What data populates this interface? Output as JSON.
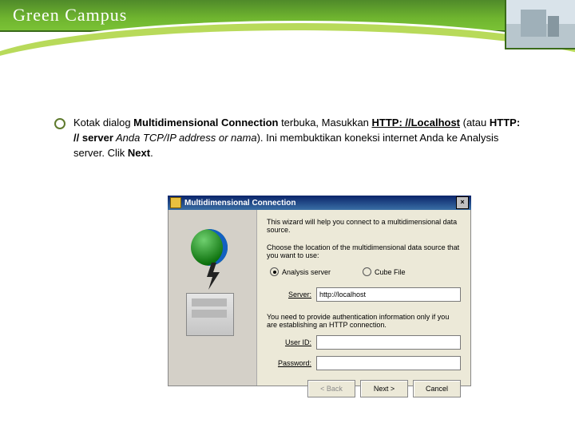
{
  "header": {
    "brand": "Green Campus"
  },
  "bullet": {
    "t1": "Kotak dialog ",
    "t2_bold": "Multidimensional Connection",
    "t3": " terbuka, Masukkan ",
    "link": "HTTP: //Localhost",
    "t4": " (atau ",
    "t5_bold": "HTTP: // server",
    "t6_ital": "  Anda TCP/IP address or nama",
    "t7": "). Ini membuktikan koneksi internet Anda ke Analysis server. Clik ",
    "t8_bold": "Next",
    "t9": "."
  },
  "dialog": {
    "title": "Multidimensional Connection",
    "close": "×",
    "line1": "This wizard will help you connect to a multidimensional data source.",
    "line2": "Choose the location of the multidimensional data source that you want to use:",
    "radio1": "Analysis server",
    "radio2": "Cube File",
    "server_label": "Server:",
    "server_value": "http://localhost",
    "note": "You need to provide authentication information only if you are establishing an HTTP connection.",
    "user_label": "User ID:",
    "user_value": "",
    "pass_label": "Password:",
    "pass_value": "",
    "btn_back": "< Back",
    "btn_next": "Next >",
    "btn_cancel": "Cancel"
  }
}
